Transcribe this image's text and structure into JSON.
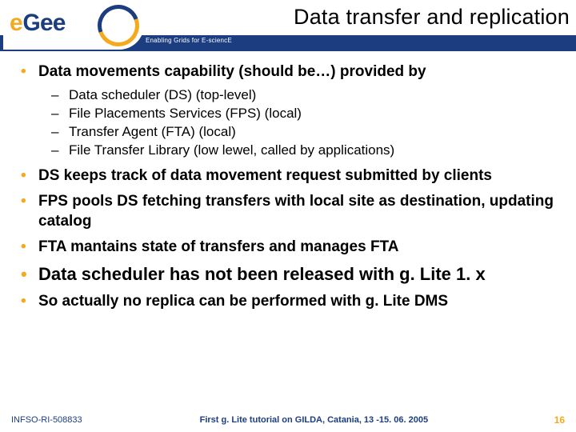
{
  "header": {
    "title": "Data transfer and replication",
    "tagline": "Enabling Grids for E-sciencE",
    "logo_alt": "eGee"
  },
  "bullets": {
    "b1": {
      "text": "Data movements capability (should be…) provided by",
      "sub0": "Data scheduler (DS) (top-level)",
      "sub1": "File Placements Services (FPS) (local)",
      "sub2": "Transfer Agent (FTA) (local)",
      "sub3": "File Transfer Library (low lewel, called by applications)"
    },
    "b2": "DS  keeps track of data movement request submitted by clients",
    "b3": "FPS  pools DS fetching transfers with local site as destination, updating catalog",
    "b4": "FTA mantains state of transfers and manages FTA",
    "b5": "Data scheduler has not been released with g. Lite 1. x",
    "b6": "So actually no replica can be performed with g. Lite DMS"
  },
  "footer": {
    "left": "INFSO-RI-508833",
    "mid": "First g. Lite tutorial on GILDA, Catania, 13 -15. 06. 2005",
    "page": "16"
  }
}
